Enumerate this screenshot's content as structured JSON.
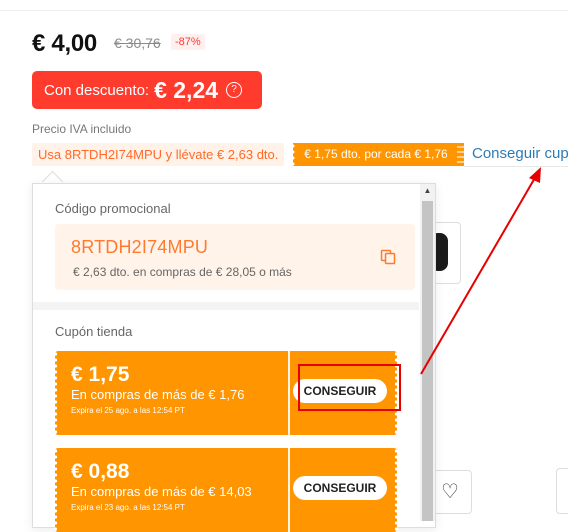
{
  "product": {
    "price": "€ 4,00",
    "original_price": "€ 30,76",
    "discount_percent": "-87%",
    "discounted_label": "Con descuento:",
    "discounted_price": "€ 2,24",
    "help_icon": "?",
    "vat_note": "Precio IVA incluido"
  },
  "coupon_tags": {
    "code_tag": "Usa 8RTDH2I74MPU y llévate € 2,63 dto.",
    "store_tag": "€ 1,75 dto. por cada € 1,76",
    "get_coupons_link": "Conseguir cup"
  },
  "popover": {
    "promo_section_label": "Código promocional",
    "promo_code": "8RTDH2I74MPU",
    "promo_desc": "€ 2,63 dto. en compras de € 28,05 o más",
    "store_section_label": "Cupón tienda",
    "coupons": [
      {
        "amount": "€ 1,75",
        "min_purchase": "En compras de más de € 1,76",
        "expiry": "Expira el 25 ago. a las 12:54 PT",
        "button": "CONSEGUIR"
      },
      {
        "amount": "€ 0,88",
        "min_purchase": "En compras de más de € 14,03",
        "expiry": "Expira el 23 ago. a las 12:54 PT",
        "button": "CONSEGUIR"
      }
    ]
  },
  "icons": {
    "heart": "♡",
    "scroll_up": "▲"
  },
  "colors": {
    "accent_red": "#ff3b2e",
    "coupon_orange": "#ff9500",
    "link_blue": "#2e7bb5",
    "annotation_red": "#e60000"
  }
}
